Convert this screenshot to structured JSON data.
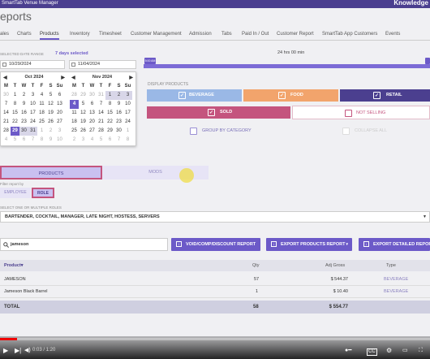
{
  "app": {
    "title": "SmartTab Venue Manager",
    "knowledge": "Knowledge"
  },
  "page_title": "eports",
  "nav": [
    {
      "label": "ales"
    },
    {
      "label": "Charts"
    },
    {
      "label": "Products",
      "active": true
    },
    {
      "label": "Inventory"
    },
    {
      "label": "Timesheet"
    },
    {
      "label": "Customer Management"
    },
    {
      "label": "Admission"
    },
    {
      "label": "Tabs"
    },
    {
      "label": "Paid In / Out"
    },
    {
      "label": "Customer Report"
    },
    {
      "label": "SmartTab App Customers"
    },
    {
      "label": "Events"
    }
  ],
  "date_range": {
    "label": "SELECTED DATE RANGE",
    "selected_text": "7 days selected",
    "start": "10/29/2024",
    "end": "11/04/2024",
    "duration": "24 hrs 00 min",
    "start_time": "5:00 AM",
    "end_time": "5:00 AM"
  },
  "calendars": [
    {
      "month": "Oct 2024",
      "dow": [
        "M",
        "T",
        "W",
        "T",
        "F",
        "S",
        "Su"
      ],
      "days": [
        {
          "d": "30",
          "m": 1
        },
        {
          "d": "1"
        },
        {
          "d": "2"
        },
        {
          "d": "3"
        },
        {
          "d": "4"
        },
        {
          "d": "5"
        },
        {
          "d": "6"
        },
        {
          "d": "7"
        },
        {
          "d": "8"
        },
        {
          "d": "9"
        },
        {
          "d": "10"
        },
        {
          "d": "11"
        },
        {
          "d": "12"
        },
        {
          "d": "13"
        },
        {
          "d": "14"
        },
        {
          "d": "15"
        },
        {
          "d": "16"
        },
        {
          "d": "17"
        },
        {
          "d": "18"
        },
        {
          "d": "19"
        },
        {
          "d": "20"
        },
        {
          "d": "21"
        },
        {
          "d": "22"
        },
        {
          "d": "23"
        },
        {
          "d": "24"
        },
        {
          "d": "25"
        },
        {
          "d": "26"
        },
        {
          "d": "27"
        },
        {
          "d": "28"
        },
        {
          "d": "29",
          "s": 1
        },
        {
          "d": "30",
          "r": 1
        },
        {
          "d": "31",
          "r": 1
        },
        {
          "d": "1",
          "m": 1
        },
        {
          "d": "2",
          "m": 1
        },
        {
          "d": "3",
          "m": 1
        },
        {
          "d": "4",
          "m": 1
        },
        {
          "d": "5",
          "m": 1
        },
        {
          "d": "6",
          "m": 1
        },
        {
          "d": "7",
          "m": 1
        },
        {
          "d": "8",
          "m": 1
        },
        {
          "d": "9",
          "m": 1
        },
        {
          "d": "10",
          "m": 1
        }
      ]
    },
    {
      "month": "Nov 2024",
      "dow": [
        "M",
        "T",
        "W",
        "T",
        "F",
        "S",
        "Su"
      ],
      "days": [
        {
          "d": "28",
          "m": 1
        },
        {
          "d": "29",
          "m": 1
        },
        {
          "d": "30",
          "m": 1
        },
        {
          "d": "31",
          "m": 1
        },
        {
          "d": "1",
          "r": 1
        },
        {
          "d": "2",
          "r": 1
        },
        {
          "d": "3",
          "r": 1
        },
        {
          "d": "4",
          "s": 1
        },
        {
          "d": "5"
        },
        {
          "d": "6"
        },
        {
          "d": "7"
        },
        {
          "d": "8"
        },
        {
          "d": "9"
        },
        {
          "d": "10"
        },
        {
          "d": "11"
        },
        {
          "d": "12"
        },
        {
          "d": "13"
        },
        {
          "d": "14"
        },
        {
          "d": "15"
        },
        {
          "d": "16"
        },
        {
          "d": "17"
        },
        {
          "d": "18"
        },
        {
          "d": "19"
        },
        {
          "d": "20"
        },
        {
          "d": "21"
        },
        {
          "d": "22"
        },
        {
          "d": "23"
        },
        {
          "d": "24"
        },
        {
          "d": "25"
        },
        {
          "d": "26"
        },
        {
          "d": "27"
        },
        {
          "d": "28"
        },
        {
          "d": "29"
        },
        {
          "d": "30"
        },
        {
          "d": "1",
          "m": 1
        },
        {
          "d": "2",
          "m": 1
        },
        {
          "d": "3",
          "m": 1
        },
        {
          "d": "4",
          "m": 1
        },
        {
          "d": "5",
          "m": 1
        },
        {
          "d": "6",
          "m": 1
        },
        {
          "d": "7",
          "m": 1
        },
        {
          "d": "8",
          "m": 1
        }
      ]
    }
  ],
  "display_products": {
    "label": "DISPLAY PRODUCTS",
    "beverage": "BEVERAGE",
    "food": "FOOD",
    "retail": "RETAIL",
    "sold": "SOLD",
    "not_selling": "NOT SELLING",
    "group_by_category": "GROUP BY CATEGORY",
    "collapse_all": "COLLAPSE ALL"
  },
  "segments": {
    "products": "PRODUCTS",
    "mods": "MODS"
  },
  "filter": {
    "label": "Filter report by",
    "employee": "EMPLOYEE",
    "role": "ROLE"
  },
  "roles": {
    "label": "SELECT ONE OR MULTIPLE ROLES",
    "value": "BARTENDER, COCKTAIL, MANAGER, LATE NIGHT, HOSTESS, SERVERS"
  },
  "search": {
    "value": "jameson"
  },
  "buttons": {
    "void": "VOID/COMP/DISCOUNT REPORT",
    "export_products": "EXPORT PRODUCTS REPORT",
    "export_detailed": "EXPORT DETAILED REPORT"
  },
  "table": {
    "headers": {
      "product": "Product▾",
      "qty": "Qty",
      "gross": "Adj Gross",
      "type": "Type"
    },
    "rows": [
      {
        "product": "JAMESON",
        "qty": "57",
        "gross": "$ 544.37",
        "type": "BEVERAGE"
      },
      {
        "product": "Jameson Black Barrel",
        "qty": "1",
        "gross": "$ 10.40",
        "type": "BEVERAGE"
      }
    ],
    "total": {
      "label": "TOTAL",
      "qty": "58",
      "gross": "$ 554.77"
    }
  },
  "video": {
    "time": "0:03 / 1:20",
    "progress": 0.04
  },
  "colors": {
    "accent": "#6c5ac8",
    "beverage": "#9ab8e6",
    "food": "#f2a46c",
    "retail": "#4b3f8f",
    "sold": "#c4547e"
  }
}
